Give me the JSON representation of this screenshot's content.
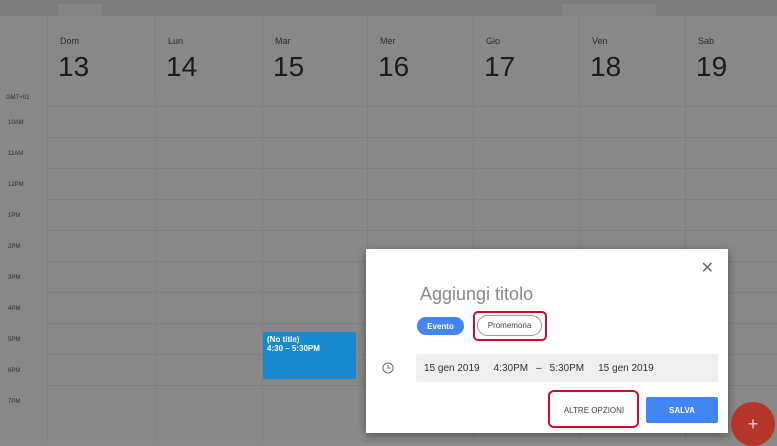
{
  "timezone": "GMT+01",
  "days": [
    {
      "name": "Dom",
      "num": "13"
    },
    {
      "name": "Lun",
      "num": "14"
    },
    {
      "name": "Mar",
      "num": "15"
    },
    {
      "name": "Mer",
      "num": "16"
    },
    {
      "name": "Gio",
      "num": "17"
    },
    {
      "name": "Ven",
      "num": "18"
    },
    {
      "name": "Sab",
      "num": "19"
    }
  ],
  "hours": [
    "10AM",
    "11AM",
    "12PM",
    "1PM",
    "2PM",
    "3PM",
    "4PM",
    "5PM",
    "6PM",
    "7PM"
  ],
  "event": {
    "title": "(No title)",
    "time": "4:30 – 5:30PM",
    "color": "#1a8ad0"
  },
  "dialog": {
    "title_placeholder": "Aggiungi titolo",
    "chip_event": "Evento",
    "chip_reminder": "Promemoria",
    "start_date": "15 gen 2019",
    "start_time": "4:30PM",
    "dash": "–",
    "end_time": "5:30PM",
    "end_date": "15 gen 2019",
    "more_options": "ALTRE OPZIONI",
    "save": "SALVA",
    "close_icon": "close-icon",
    "accent": "#4286f4",
    "highlight": "#c8102e"
  },
  "fab": {
    "icon": "+",
    "color": "#b5352a"
  }
}
